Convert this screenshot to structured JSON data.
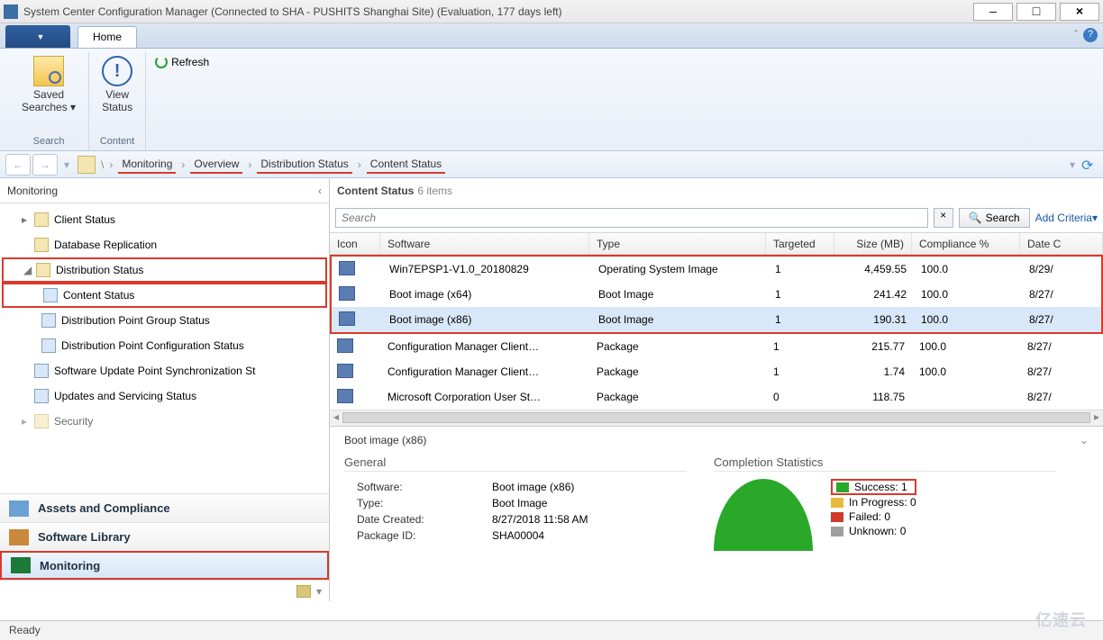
{
  "window": {
    "title": "System Center Configuration Manager (Connected to SHA - PUSHITS Shanghai Site) (Evaluation, 177 days left)",
    "minimize": "–",
    "maximize": "□",
    "close": "×"
  },
  "tabs": {
    "home": "Home"
  },
  "ribbon": {
    "saved_searches": "Saved\nSearches",
    "dropdown_marker": "▾",
    "view_status": "View\nStatus",
    "refresh": "Refresh",
    "group_search": "Search",
    "group_content": "Content"
  },
  "nav": {
    "back": "←",
    "forward": "→",
    "drop": "▾",
    "refresh": "⟳"
  },
  "breadcrumb": [
    "Monitoring",
    "Overview",
    "Distribution Status",
    "Content Status"
  ],
  "left_title": "Monitoring",
  "tree": {
    "client_status": "Client Status",
    "db_repl": "Database Replication",
    "dist_status": "Distribution Status",
    "content_status": "Content Status",
    "dp_group": "Distribution Point Group Status",
    "dp_config": "Distribution Point Configuration Status",
    "sup_sync": "Software Update Point Synchronization St",
    "updates_serv": "Updates and Servicing Status",
    "security": "Security"
  },
  "wunderbar": {
    "assets": "Assets and Compliance",
    "library": "Software Library",
    "monitoring": "Monitoring"
  },
  "content": {
    "title": "Content Status",
    "count": "6 items",
    "search_placeholder": "Search",
    "search_btn": "Search",
    "add_criteria": "Add Criteria",
    "cols": {
      "icon": "Icon",
      "software": "Software",
      "type": "Type",
      "targeted": "Targeted",
      "size": "Size (MB)",
      "compliance": "Compliance %",
      "date": "Date C"
    },
    "rows": [
      {
        "software": "Win7EPSP1-V1.0_20180829",
        "type": "Operating System Image",
        "targeted": "1",
        "size": "4,459.55",
        "compliance": "100.0",
        "date": "8/29/"
      },
      {
        "software": "Boot image (x64)",
        "type": "Boot Image",
        "targeted": "1",
        "size": "241.42",
        "compliance": "100.0",
        "date": "8/27/"
      },
      {
        "software": "Boot image (x86)",
        "type": "Boot Image",
        "targeted": "1",
        "size": "190.31",
        "compliance": "100.0",
        "date": "8/27/"
      },
      {
        "software": "Configuration Manager Client…",
        "type": "Package",
        "targeted": "1",
        "size": "215.77",
        "compliance": "100.0",
        "date": "8/27/"
      },
      {
        "software": "Configuration Manager Client…",
        "type": "Package",
        "targeted": "1",
        "size": "1.74",
        "compliance": "100.0",
        "date": "8/27/"
      },
      {
        "software": "Microsoft Corporation User St…",
        "type": "Package",
        "targeted": "0",
        "size": "118.75",
        "compliance": "",
        "date": "8/27/"
      }
    ]
  },
  "detail": {
    "title": "Boot image (x86)",
    "general": "General",
    "stats_title": "Completion Statistics",
    "kv": {
      "software_k": "Software:",
      "software_v": "Boot image (x86)",
      "type_k": "Type:",
      "type_v": "Boot Image",
      "date_k": "Date Created:",
      "date_v": "8/27/2018 11:58 AM",
      "pkg_k": "Package ID:",
      "pkg_v": "SHA00004"
    },
    "legend": {
      "success": "Success: 1",
      "progress": "In Progress: 0",
      "failed": "Failed: 0",
      "unknown": "Unknown: 0"
    }
  },
  "status": "Ready",
  "watermark": "亿速云"
}
